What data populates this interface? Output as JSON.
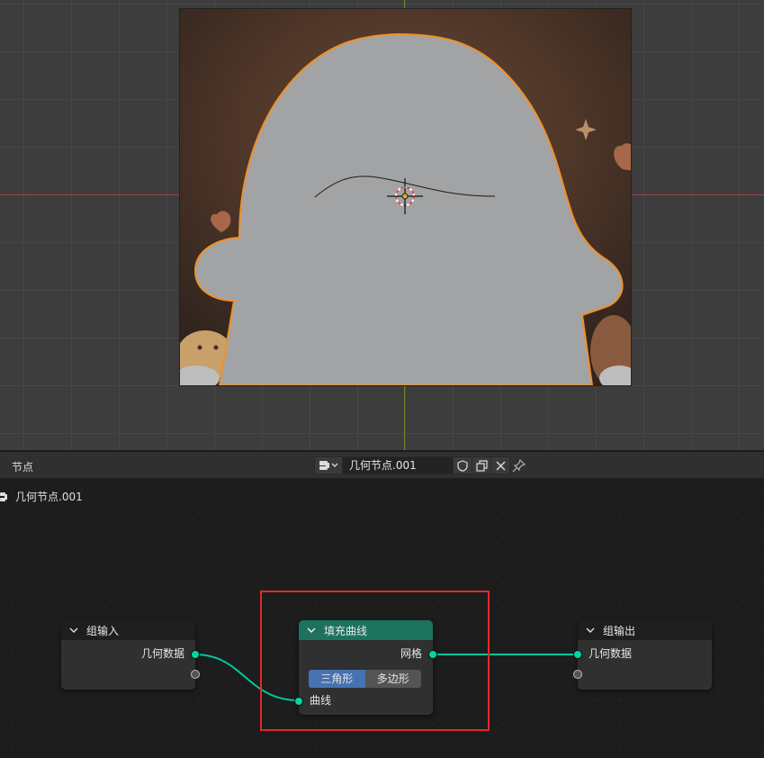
{
  "viewport": {
    "colors": {
      "background": "#3d3d3d",
      "grid": "#474747",
      "x_axis": "#a8404a",
      "y_axis": "#6a8a2a",
      "shape_fill": "#a2a3a5",
      "shape_outline": "#f0902a"
    }
  },
  "node_editor": {
    "editor_label": "节点",
    "datablock_name": "几何节点.001",
    "datablock_icons": [
      "node-tree-icon",
      "chevron-down-icon",
      "shield-icon",
      "duplicate-icon",
      "close-icon"
    ],
    "pin_icon": "pin-icon",
    "breadcrumb": "几何节点.001"
  },
  "nodes": {
    "group_input": {
      "title": "组输入",
      "outputs": [
        "几何数据"
      ]
    },
    "fill_curve": {
      "title": "填充曲线",
      "header_color": "#1d725e",
      "output": "网格",
      "mode_options": [
        "三角形",
        "多边形"
      ],
      "selected_mode": "三角形",
      "input": "曲线"
    },
    "group_output": {
      "title": "组输出",
      "inputs": [
        "几何数据"
      ]
    }
  },
  "colors": {
    "geometry_socket": "#00d6a3",
    "link": "#00c896",
    "selected_mode": "#4772b3",
    "highlight_box": "#e02a2a"
  }
}
